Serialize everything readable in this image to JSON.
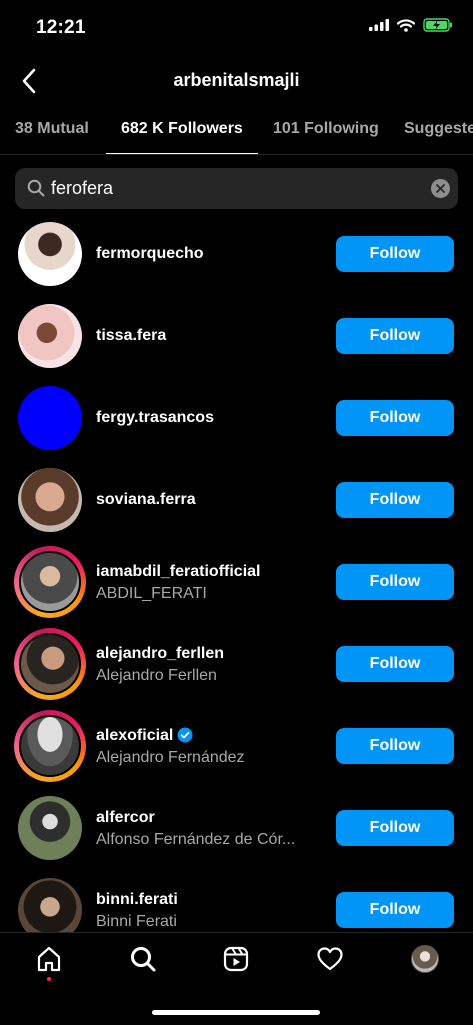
{
  "status_bar": {
    "time": "12:21"
  },
  "header": {
    "title": "arbenitalsmajli"
  },
  "tabs": [
    {
      "label": "38 Mutual"
    },
    {
      "label": "682 K Followers"
    },
    {
      "label": "101 Following"
    },
    {
      "label": "Suggested"
    }
  ],
  "search": {
    "value": "ferofera",
    "placeholder": "Search"
  },
  "follow_label": "Follow",
  "users": [
    {
      "username": "fermorquecho",
      "fullname": "",
      "avatar_color": "#d9c7c0"
    },
    {
      "username": "tissa.fera",
      "fullname": "",
      "avatar_color": "#e6b8b0"
    },
    {
      "username": "fergy.trasancos",
      "fullname": "",
      "avatar_color": "#0000ff"
    },
    {
      "username": "soviana.ferra",
      "fullname": "",
      "avatar_color": "#8a6a55"
    },
    {
      "username": "iamabdil_feratiofficial",
      "fullname": "ABDIL_FERATI",
      "avatar_color": "#6b6b6b"
    },
    {
      "username": "alejandro_ferllen",
      "fullname": "Alejandro Ferllen",
      "avatar_color": "#5a4a3e"
    },
    {
      "username": "alexoficial",
      "fullname": "Alejandro Fernández",
      "avatar_color": "#7a7a7a"
    },
    {
      "username": "alfercor",
      "fullname": "Alfonso Fernández de Cór...",
      "avatar_color": "#56664a"
    },
    {
      "username": "binni.ferati",
      "fullname": "Binni Ferati",
      "avatar_color": "#4a3a30"
    }
  ],
  "colors": {
    "accent": "#0095f6",
    "background": "#000000",
    "secondary_text": "#a8a8a8"
  }
}
